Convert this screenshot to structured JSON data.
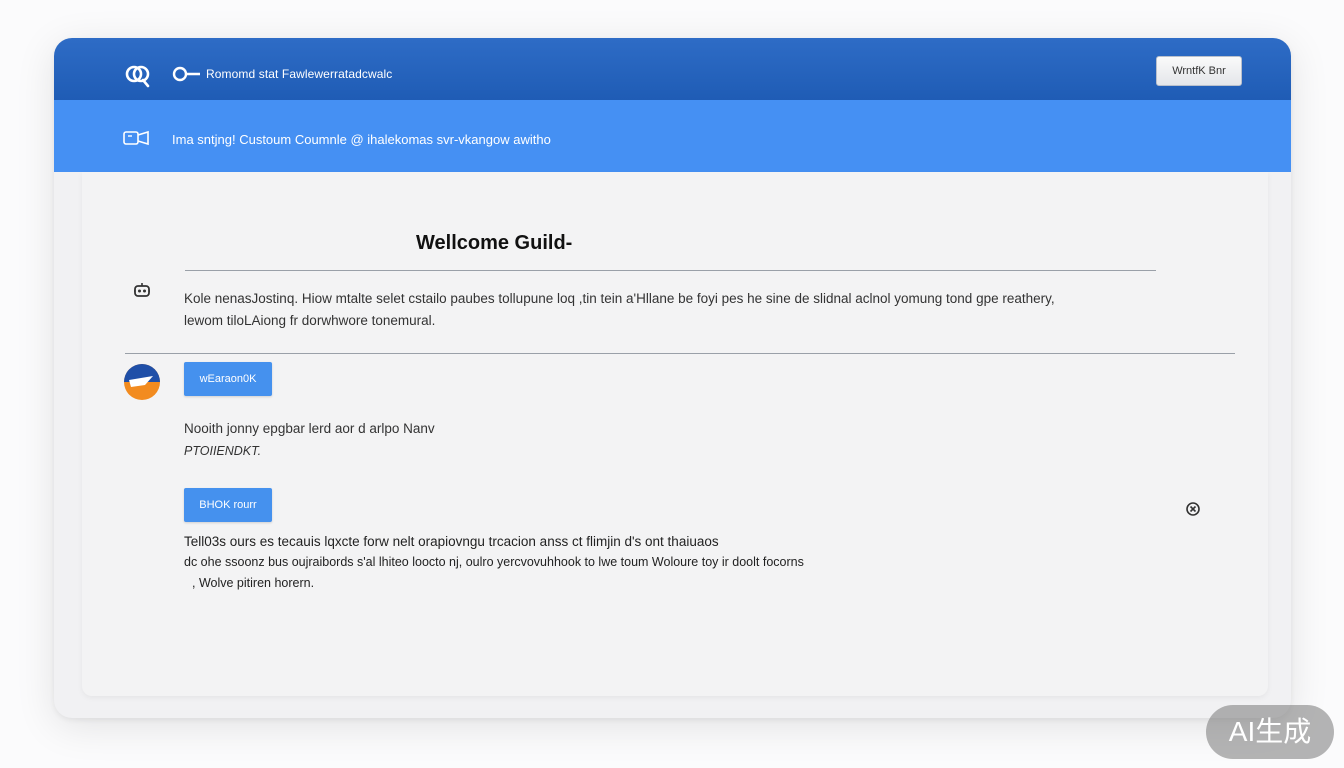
{
  "header": {
    "app_title": "Romomd stat  Fawlewerratadcwalc",
    "top_button_label": "WrntfK Bnr"
  },
  "subheader": {
    "text": "Ima sntjng! Custoum Coumnle  @  ihalekomas svr-vkangow awitho"
  },
  "main": {
    "title": "Wellcome Guild-",
    "intro_lines": [
      "Kole nenasJostinq.   Hiow mtalte selet cstailo paubes tollupune loq ,tin tein a'Hllane be foyi pes he sine de slidnal aclnol yomung tond gpe reathery,",
      "lewom tiloLAiong fr dorwhwore tonemural."
    ],
    "button1_label": "wEaraon0K",
    "section1_lines": [
      "Nooith jonny  epgbar lerd aor d arlpo Nanv",
      "PTOIIENDKT."
    ],
    "button2_label": "BHOK rourr",
    "section2_lines": [
      "Tell03s ours  es tecauis lqxcte forw nelt orapiovngu trcacion anss ct flimjin d's ont thaiuaos",
      "dc ohe ssoonz bus oujraibords s'al lhiteo loocto nj, oulro yercvovuhhook to lwe  toum Woloure toy ir doolt focorns",
      ", Wolve pitiren horern."
    ]
  },
  "watermark": {
    "label": "AI生成"
  },
  "colors": {
    "topbar": "#1f5cb5",
    "subbar": "#4590f3",
    "button": "#4591ee"
  },
  "icons": [
    "app-logo-icon",
    "key-icon",
    "message-icon",
    "robot-icon",
    "browser-badge-icon",
    "close-icon"
  ]
}
